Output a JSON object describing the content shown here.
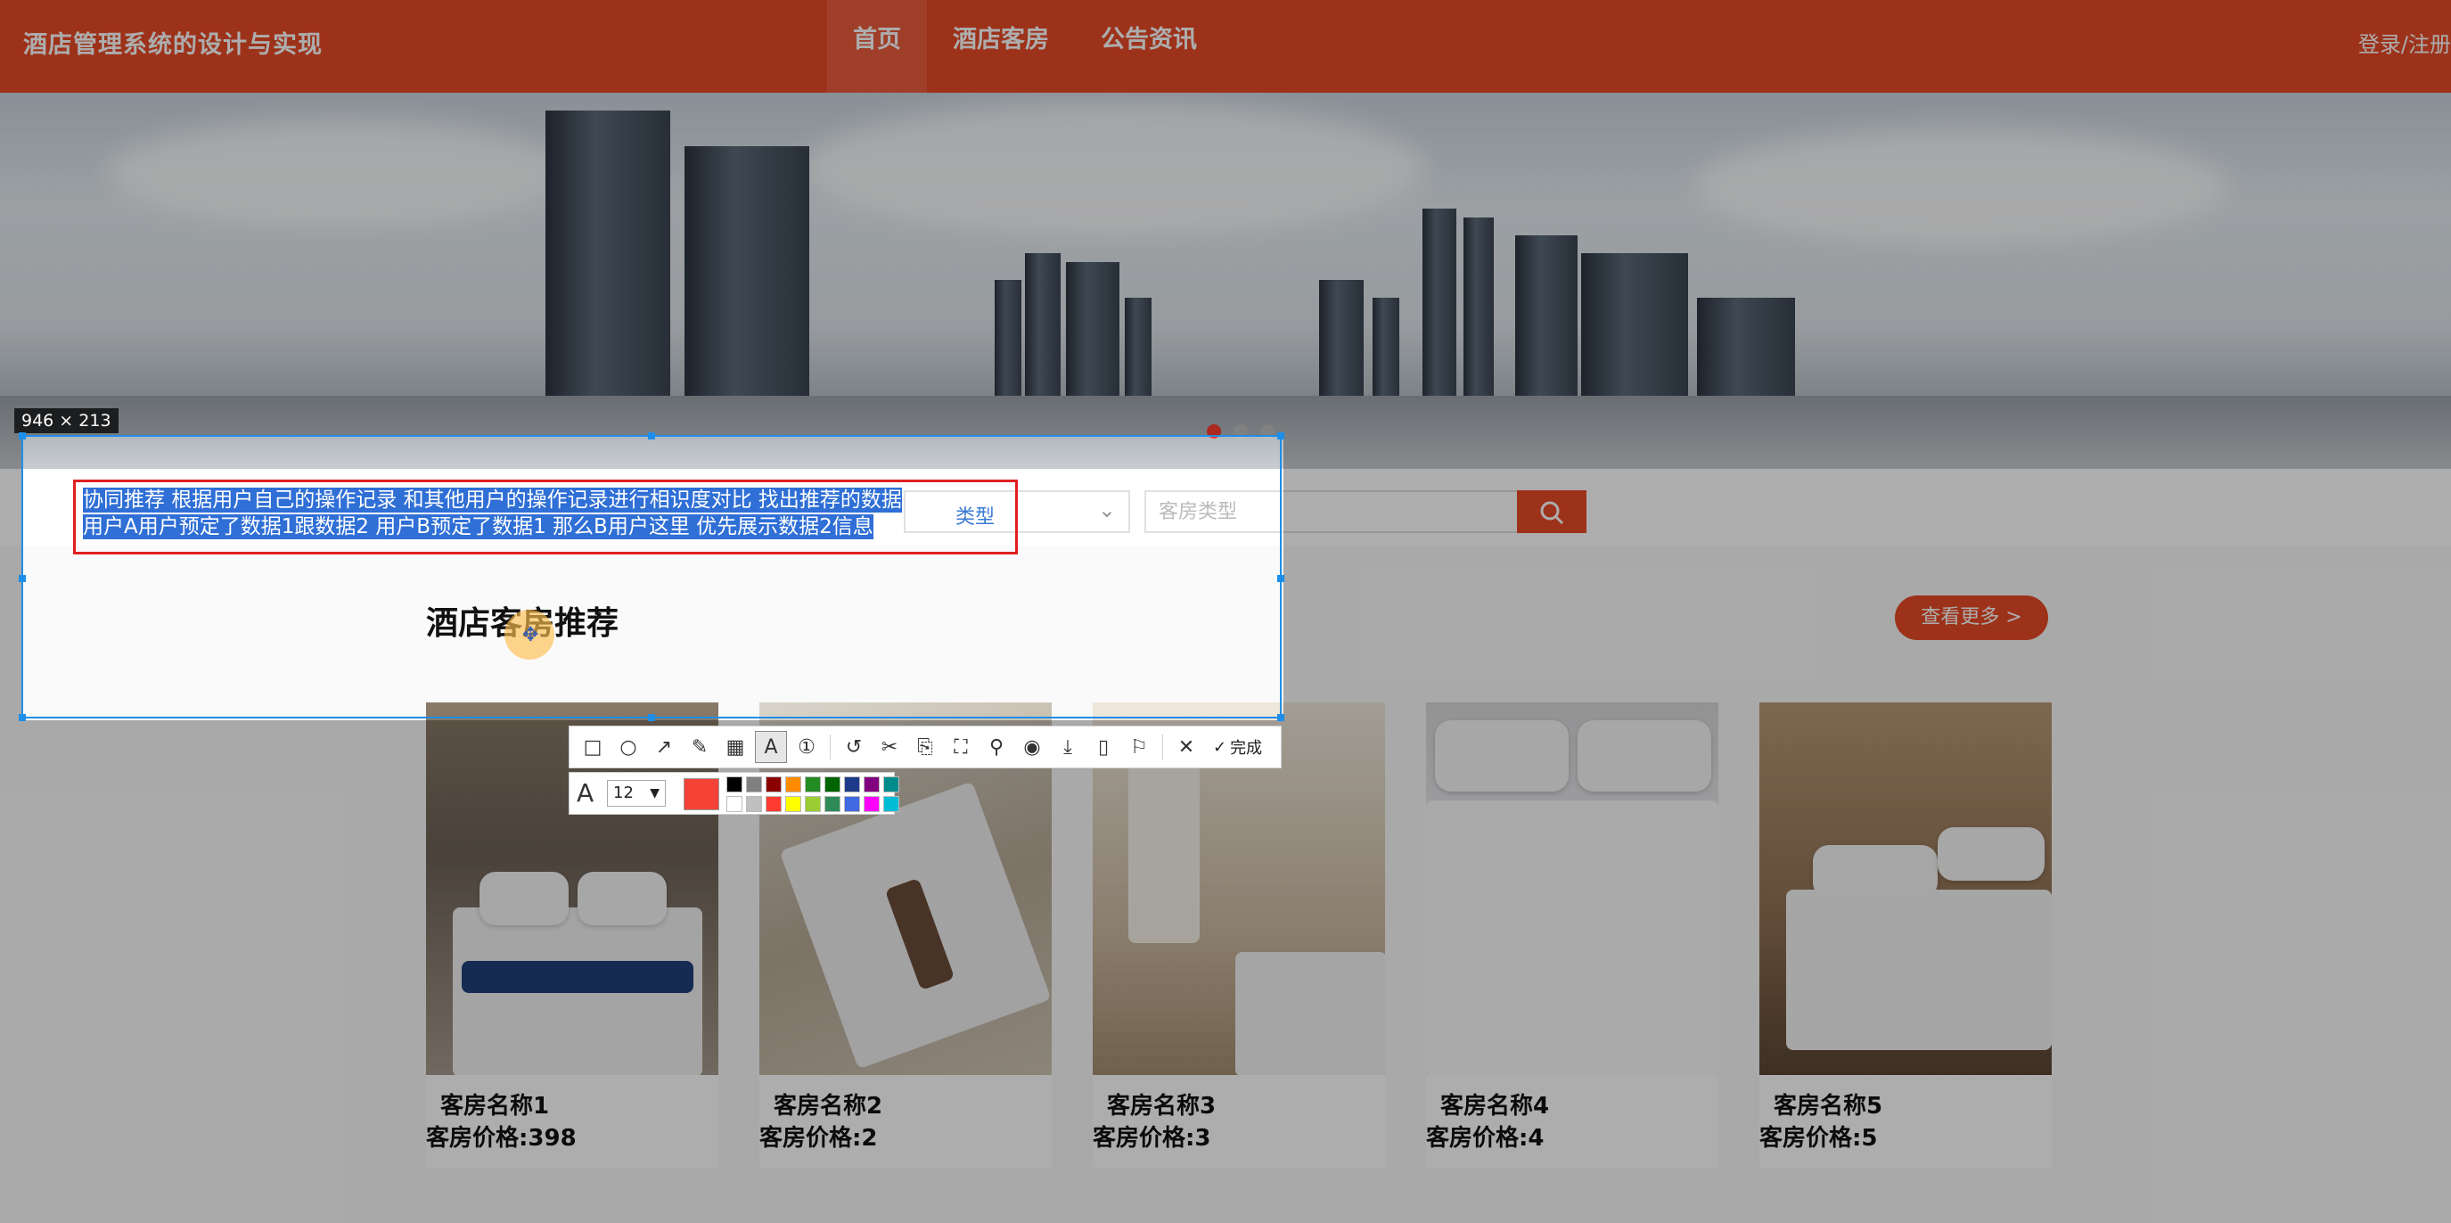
{
  "site": {
    "title": "酒店管理系统的设计与实现",
    "nav": [
      {
        "label": "首页",
        "active": true
      },
      {
        "label": "酒店客房",
        "active": false
      },
      {
        "label": "公告资讯",
        "active": false
      }
    ],
    "login_label": "登录/注册"
  },
  "search": {
    "type_select_value": "类型",
    "input_placeholder": "客房类型"
  },
  "recommend": {
    "title": "酒店客房推荐",
    "more_label": "查看更多 >",
    "rooms": [
      {
        "name": "客房名称1",
        "price": "客房价格:398"
      },
      {
        "name": "客房名称2",
        "price": "客房价格:2"
      },
      {
        "name": "客房名称3",
        "price": "客房价格:3"
      },
      {
        "name": "客房名称4",
        "price": "客房价格:4"
      },
      {
        "name": "客房名称5",
        "price": "客房价格:5"
      }
    ]
  },
  "screenshot_tool": {
    "size_label": "946 × 213",
    "note_lines": [
      "协同推荐  根据用户自己的操作记录 和其他用户的操作记录进行相识度对比  找出推荐的数据",
      "用户A用户预定了数据1跟数据2    用户B预定了数据1  那么B用户这里 优先展示数据2信息"
    ],
    "done_label": "完成",
    "font_size": "12",
    "current_color": "#f44336",
    "palette": [
      "#000000",
      "#808080",
      "#8b0000",
      "#ff8c00",
      "#228b22",
      "#006400",
      "#1e3a8a",
      "#800080",
      "#008b8b",
      "#ffffff",
      "#c0c0c0",
      "#ff3b30",
      "#ffff00",
      "#9acd32",
      "#2e8b57",
      "#4169e1",
      "#ff00ff",
      "#00bcd4"
    ],
    "tools": [
      "rectangle-icon",
      "circle-icon",
      "arrow-icon",
      "pencil-icon",
      "mosaic-icon",
      "text-icon",
      "serial-number-icon",
      "undo-icon",
      "scissors-icon",
      "translate-icon",
      "ocr-icon",
      "pin-icon",
      "record-icon",
      "download-icon",
      "phone-icon",
      "bookmark-icon",
      "close-icon"
    ]
  },
  "colors": {
    "accent": "#e84b27",
    "selection": "#1e8ee8",
    "note_border": "#e02020"
  }
}
